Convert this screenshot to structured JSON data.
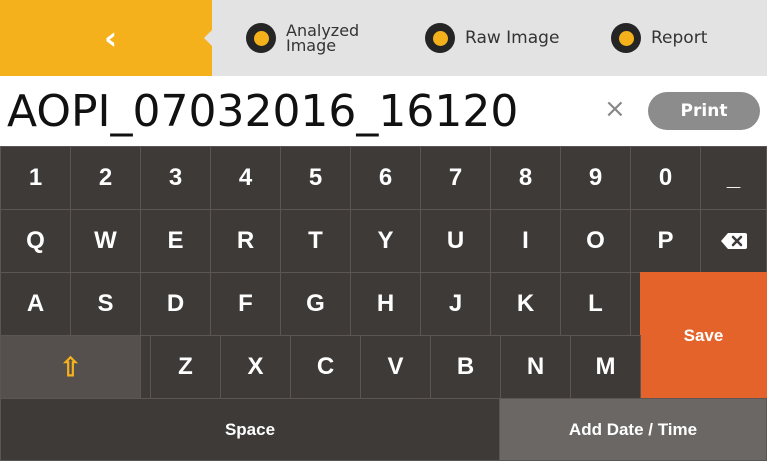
{
  "topbar": {
    "back_icon": "chevron-left-icon",
    "tabs": [
      {
        "label_line1": "Analyzed",
        "label_line2": "Image"
      },
      {
        "label": "Raw Image"
      },
      {
        "label": "Report"
      }
    ]
  },
  "filename": {
    "value": "AOPI_07032016_16120",
    "clear_symbol": "×"
  },
  "print_label": "Print",
  "keyboard": {
    "row1": [
      "1",
      "2",
      "3",
      "4",
      "5",
      "6",
      "7",
      "8",
      "9",
      "0",
      "_"
    ],
    "row2": [
      "Q",
      "W",
      "E",
      "R",
      "T",
      "Y",
      "U",
      "I",
      "O",
      "P"
    ],
    "row3": [
      "A",
      "S",
      "D",
      "F",
      "G",
      "H",
      "J",
      "K",
      "L"
    ],
    "row4": [
      "Z",
      "X",
      "C",
      "V",
      "B",
      "N",
      "M"
    ],
    "shift_symbol": "⇧",
    "backspace_icon": "backspace-icon",
    "save_label": "Save",
    "space_label": "Space",
    "add_date_label": "Add Date / Time"
  },
  "colors": {
    "accent": "#f4b11c",
    "save": "#e3632a",
    "key_bg": "#3e3a38"
  }
}
